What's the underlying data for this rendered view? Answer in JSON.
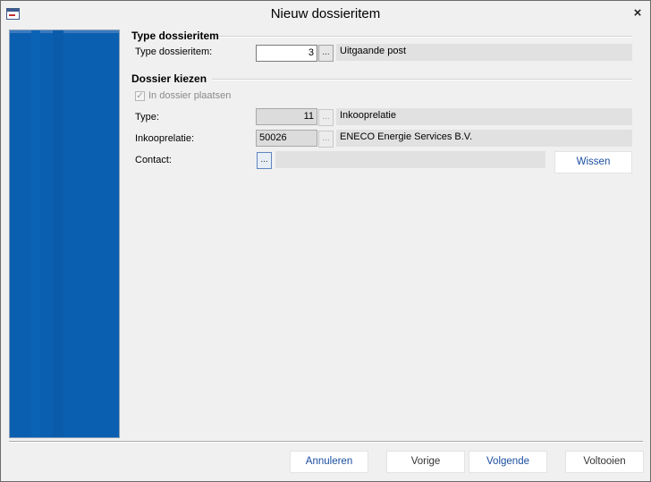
{
  "window": {
    "title": "Nieuw dossieritem",
    "close_glyph": "×"
  },
  "section_type": {
    "title": "Type dossieritem",
    "field_label": "Type dossieritem:",
    "field_value": "3",
    "button_label": "...",
    "description": "Uitgaande post"
  },
  "section_dossier": {
    "title": "Dossier kiezen",
    "checkbox_label": "In dossier plaatsen",
    "checkbox_glyph": "✓",
    "type": {
      "label": "Type:",
      "value": "11",
      "button_label": "...",
      "description": "Inkooprelatie"
    },
    "relation": {
      "label": "Inkooprelatie:",
      "value": "50026",
      "button_label": "...",
      "description": "ENECO Energie Services B.V."
    },
    "contact": {
      "label": "Contact:",
      "button_label": "...",
      "description": "",
      "clear_label": "Wissen"
    }
  },
  "footer": {
    "cancel": "Annuleren",
    "previous": "Vorige",
    "next": "Volgende",
    "finish": "Voltooien"
  },
  "colors": {
    "side_panel": "#0a5fb0",
    "link_blue": "#1a4da0"
  },
  "icons": {
    "app": "dossier-window-icon",
    "close": "close-icon"
  }
}
